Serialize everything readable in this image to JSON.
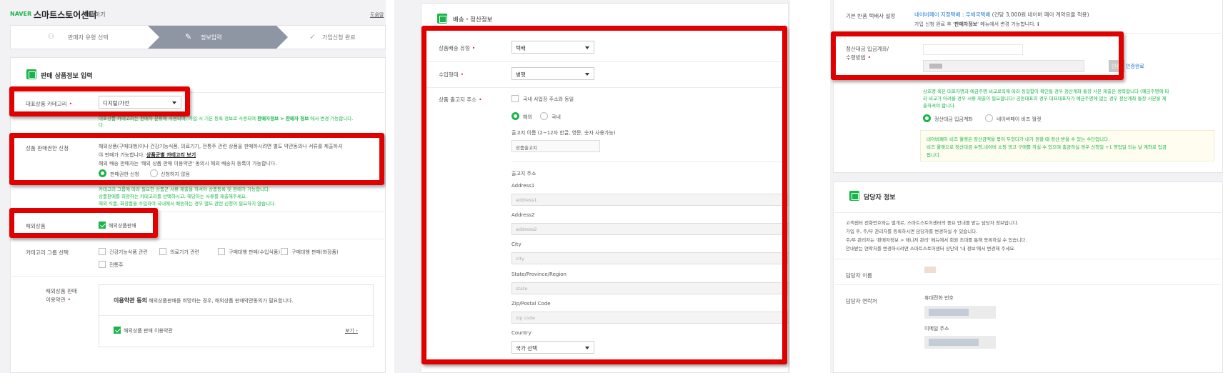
{
  "left": {
    "brand": "NAVER",
    "title": "스마트스토어센터",
    "subtitle": "가입하기",
    "help": "도움말",
    "steps": [
      "판매자 유형 선택",
      "정보입력",
      "가입신청 완료"
    ],
    "section_title": "판매 상품정보 입력",
    "category_label": "대표상품 카테고리",
    "category_value": "디지털/가전",
    "category_help_pre": "대표상품 카테고리는 판매자 분류에 사용되며, 가입 시 기본 등록 정보로 사용되며 ",
    "category_help_link": "판매자정보 > 판매자 정보",
    "category_help_post": " 에서 변경 가능합니다.",
    "permission_label": "상품 판매권한 신청",
    "permission_text1": "해외상품(구매대행)이나 건강기능식품, 의료기기, 전통주 관련 상품을 판매하시려면 별도 약관동의나 서류를 제출하셔",
    "permission_text2_pre": "야 판매가 가능합니다. ",
    "permission_text2_link": "상품군별 카테고리 보기",
    "permission_text3": "해외 배송 판매자는 '해외 상품 판매 이용약관' 동의시 해외 배송처 등록이 가능합니다.",
    "permission_opt1": "판매권한 신청",
    "permission_opt2": "신청하지 않음",
    "green_note1": "카테고리 그룹에 따라 필요한 상품군 서류 제출을 하셔야 상품등록 및 판매가 가능합니다.",
    "green_note2": "상품판매를 희망하는 카테고리를 선택하시고, 해당하는 서류를 제출해주세요.",
    "green_note3": "해외 식품, 화장품을 수입하여 국내에서 배송하는 경우 별도 관련 신청이 필요하지 않습니다.",
    "overseas_label": "해외상품",
    "overseas_check": "해외상품판매",
    "group_label": "카테고리 그룹 선택",
    "groups": [
      "건강기능식품 관련",
      "의료기기 관련",
      "구매대행 판매(수입식품)",
      "구매대행 판매(화장품)",
      "전통주"
    ],
    "terms_label1": "해외상품 판매",
    "terms_label2": "이용약관",
    "terms_title": "이용약관 동의",
    "terms_desc": " 해외상품판매를 희망하는 경우, 해외상품 판매약관동의가 필요합니다.",
    "terms_check": "해외상품 판매 이용약관",
    "terms_view": "보기"
  },
  "middle": {
    "section_title": "배송・정산정보",
    "delivery_type_label": "상품배송 유형",
    "delivery_type_value": "택배",
    "import_label": "수입형태",
    "import_value": "병행",
    "origin_label": "상품 출고지 주소",
    "same_as_biz": "국내 사업장 주소와 동일",
    "radio_overseas": "해외",
    "radio_domestic": "국내",
    "origin_name_label": "출고지 이름 (2~12자 한글, 영문, 숫자 사용가능)",
    "origin_name_value": "상품출고지",
    "origin_addr_label": "출고지 주소",
    "fields": [
      {
        "label": "Address1",
        "placeholder": "address1"
      },
      {
        "label": "Address2",
        "placeholder": "address2"
      },
      {
        "label": "City",
        "placeholder": "city"
      },
      {
        "label": "State/Province/Region",
        "placeholder": "state"
      },
      {
        "label": "Zip/Postal Code",
        "placeholder": "zip code"
      }
    ],
    "country_label": "Country",
    "country_value": "국가 선택"
  },
  "right": {
    "return_label": "기본 반품 택배사 설정",
    "return_value_link": "네이버페이 지정택배 : 우체국택배",
    "return_value_rest": " (건당 3,000원 네이버 페이 계약요율 적용)",
    "return_note_pre": "가입 신청 완료 후 '",
    "return_note_bold": "판매자정보",
    "return_note_post": "' 메뉴에서 변경 가능합니다.",
    "settle_label1": "정산대금 입금계좌/",
    "settle_label2": "수령방법",
    "verify_button": "인증",
    "verify_done": "인증완료",
    "settle_note1": "상호명 혹은 대표자명과 예금주명 비교로직에 따라 동일함이 확인될 경우 정산계좌 통장 사본 제출은 생략합니다 (예금주명에 따",
    "settle_note2": "라 비교가 어려울 경우 서류 제출이 필요합니다) 공동대표의 경우 대표대표자가 예금주명에 없는 경우 정산계좌 통장 사본을 제",
    "settle_note3": "출하셔야 합니다.",
    "settle_opt1": "정산대금 입금계좌",
    "settle_opt2": "네이버페이 비즈 월렛",
    "wallet_note1": "네이버페이 비즈 월렛은 정산금액을 묶어 두었다가 내가 원할 때 정산 받을 수 있는 수단입니다.",
    "wallet_note2": "비즈 월렛으로 정산대금 수령,네이버 쇼핑 광고 구매를 하실 수 있으며 출금하실 경우 신청일 +1 영업일 되는 날 계좌로 입금",
    "wallet_note3": "됩니다.",
    "contact_title": "담당자 정보",
    "contact_desc1": "고객센터 전화번호와는 별개로, 스마트스토어센터의 중요 안내를 받는 담당자 정보입니다.",
    "contact_desc2": "가입 후, 주/부 관리자를 등록하시면 담당자를 변경하실 수 있습니다.",
    "contact_desc3": "주/부 관리자는 '판매자정보 > 매니저 관리' 메뉴에서 회원 초대를 통해 등록하실 수 있습니다.",
    "contact_desc4": "안내받는 연락처를 변경하시려면 스마트스토어센터 상단의 '내 정보'에서 변경해 주세요.",
    "name_label": "담당자 이름",
    "phone_label": "담당자 연락처",
    "mobile_label": "휴대전화 번호",
    "email_label": "이메일 주소"
  },
  "colors": {
    "accent": "#19b54a",
    "highlight": "#e10000",
    "link": "#1e78d2"
  }
}
